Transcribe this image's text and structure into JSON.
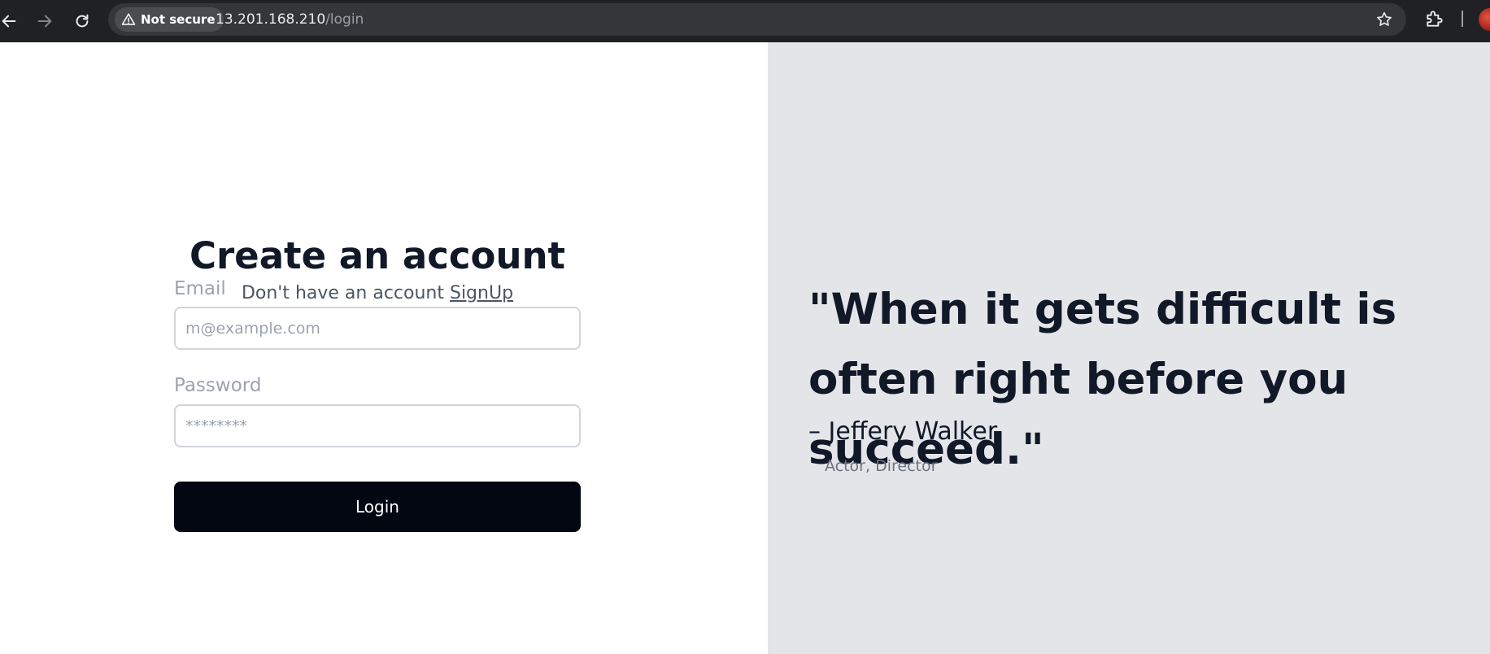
{
  "browser": {
    "security_label": "Not secure",
    "url_host": "13.201.168.210",
    "url_path": "/login"
  },
  "icons": {
    "back": "arrow-left-icon",
    "forward": "arrow-right-icon",
    "reload": "reload-icon",
    "warning": "warning-triangle-icon",
    "bookmark": "star-icon",
    "extensions": "puzzle-icon",
    "profile": "avatar"
  },
  "form": {
    "title": "Create an account",
    "subtitle_text": "Don't have an account",
    "signup_link": "SignUp",
    "email_label": "Email",
    "email_placeholder": "m@example.com",
    "password_label": "Password",
    "password_placeholder": "********",
    "login_button": "Login"
  },
  "quote": {
    "text": "\"When it gets difficult is often right before you succeed.\"",
    "author": "– Jeffery Walker",
    "role": "Actor, Director"
  },
  "colors": {
    "chrome_bg": "#202124",
    "right_panel_bg": "#e4e5e9",
    "button_bg": "#030712",
    "heading": "#111827"
  }
}
